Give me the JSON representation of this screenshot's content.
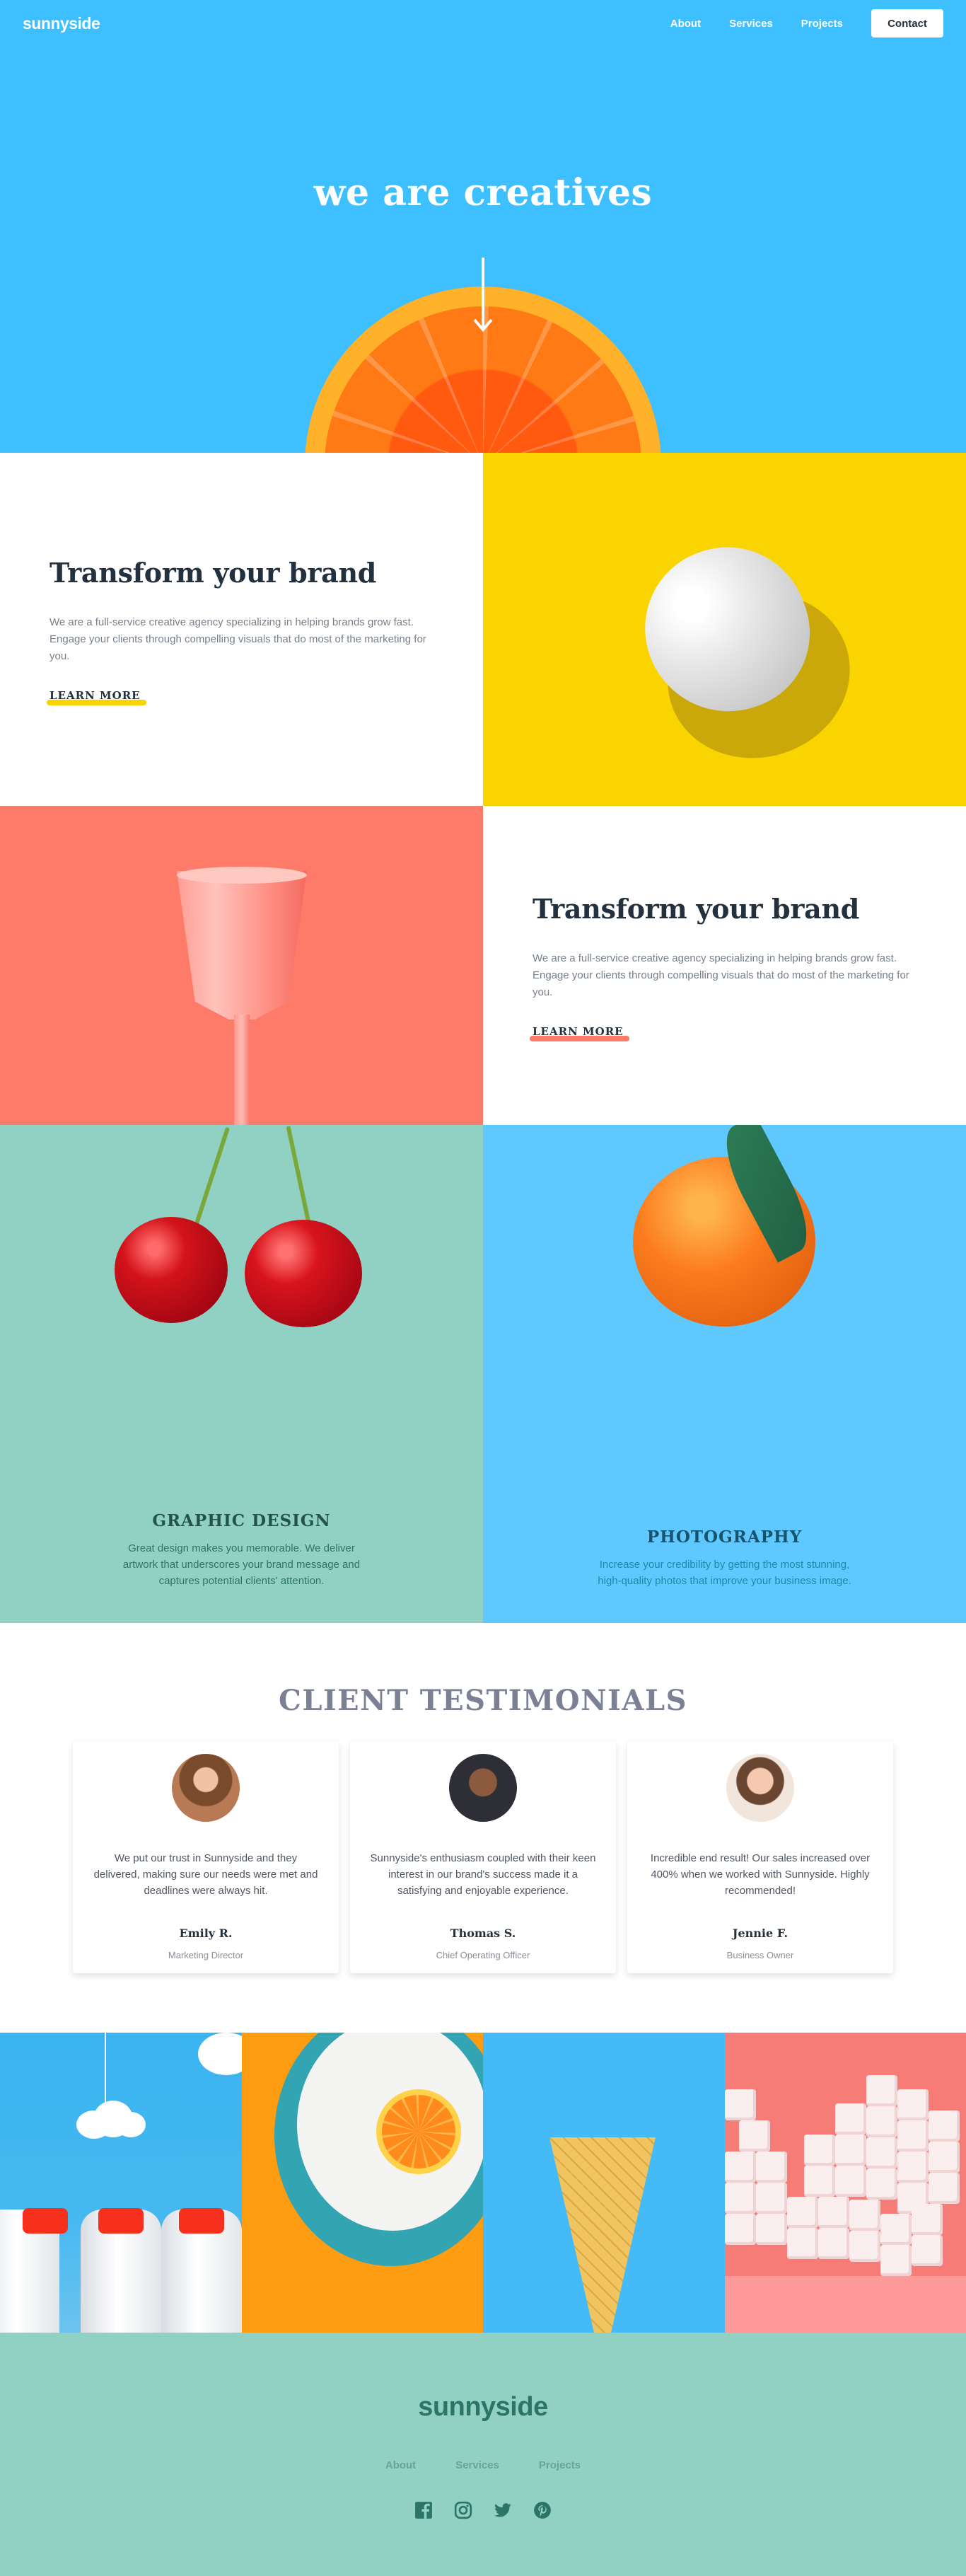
{
  "header": {
    "logo": "sunnyside",
    "nav": [
      "About",
      "Services",
      "Projects"
    ],
    "contact_label": "Contact"
  },
  "hero": {
    "title": "we are creatives",
    "arrow_icon": "arrow-down-icon"
  },
  "features": [
    {
      "title": "Transform your brand",
      "text": "We are a full-service creative agency specializing in helping brands grow fast. Engage your clients through compelling visuals that do most of the marketing for you.",
      "link": "LEARN MORE",
      "highlight_color": "#fad400"
    },
    {
      "title": "Transform your brand",
      "text": "We are a full-service creative agency specializing in helping brands grow fast. Engage your clients through compelling visuals that do most of the marketing for you.",
      "link": "LEARN MORE",
      "highlight_color": "#ff7b69"
    }
  ],
  "services": [
    {
      "title": "GRAPHIC DESIGN",
      "text": "Great design makes you memorable. We deliver artwork that underscores your brand message and captures potential clients' attention."
    },
    {
      "title": "PHOTOGRAPHY",
      "text": "Increase your credibility by getting the most stunning, high-quality photos that improve your business image."
    }
  ],
  "testimonials": {
    "heading": "CLIENT TESTIMONIALS",
    "items": [
      {
        "quote": "We put our trust in Sunnyside and they delivered, making sure our needs were met and deadlines were always hit.",
        "name": "Emily R.",
        "role": "Marketing Director"
      },
      {
        "quote": "Sunnyside's enthusiasm coupled with their keen interest in our brand's success made it a satisfying and enjoyable experience.",
        "name": "Thomas S.",
        "role": "Chief Operating Officer"
      },
      {
        "quote": "Incredible end result! Our sales increased over 400% when we worked with Sunnyside. Highly recommended!",
        "name": "Jennie F.",
        "role": "Business Owner"
      }
    ]
  },
  "footer": {
    "logo": "sunnyside",
    "links": [
      "About",
      "Services",
      "Projects"
    ],
    "socials": [
      "facebook-icon",
      "instagram-icon",
      "twitter-icon",
      "pinterest-icon"
    ]
  },
  "colors": {
    "hero_bg": "#3ebfff",
    "yellow": "#fad400",
    "salmon": "#ff7b69",
    "green": "#90d1c4",
    "light_blue": "#5fc9ff"
  }
}
